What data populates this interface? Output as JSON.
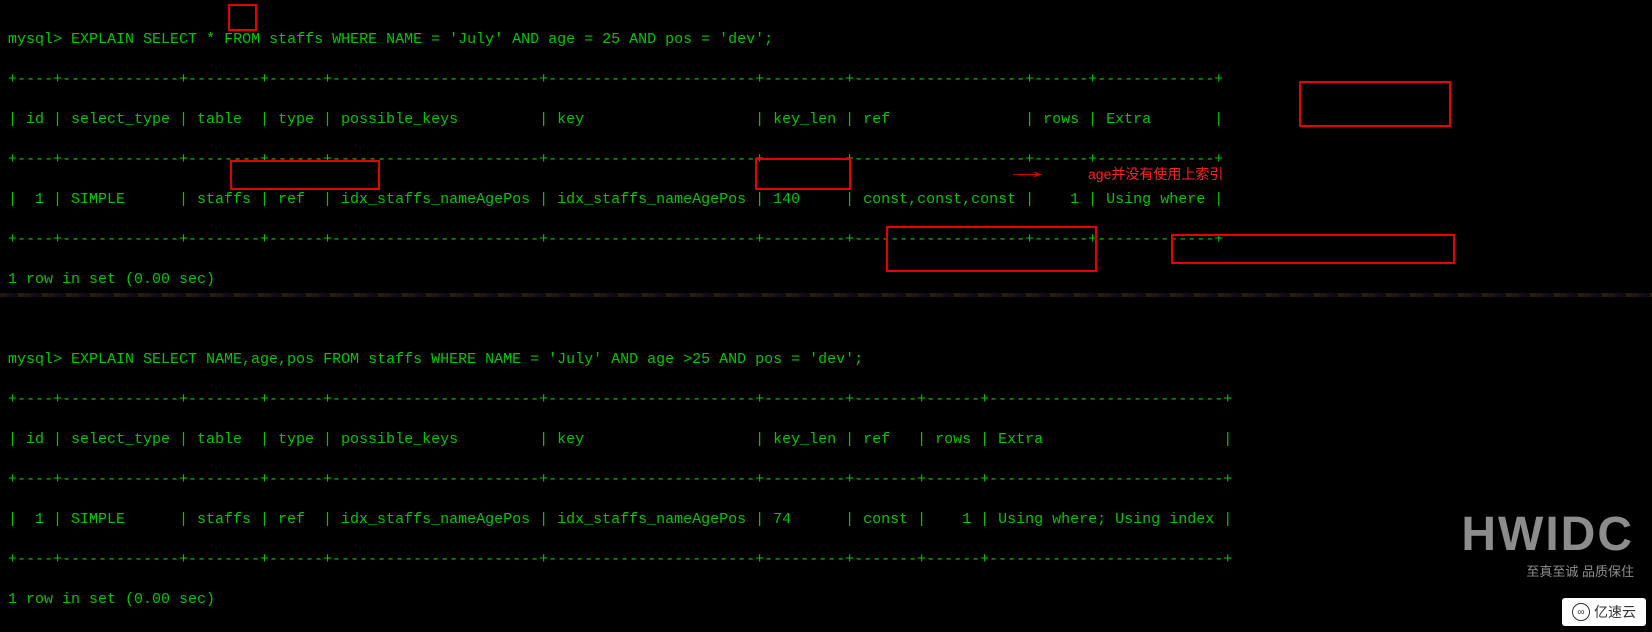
{
  "query1": {
    "prompt": "mysql> ",
    "sql_pre": "EXPLAIN SELECT ",
    "star": "*",
    "sql_post": " FROM staffs WHERE NAME = 'July' AND age = 25 AND pos = 'dev';",
    "sep_top": "+----+-------------+--------+------+-----------------------+-----------------------+---------+-------------------+------+-------------+",
    "header": "| id | select_type | table  | type | possible_keys         | key                   | key_len | ref               | rows | Extra       |",
    "sep_mid": "+----+-------------+--------+------+-----------------------+-----------------------+---------+-------------------+------+-------------+",
    "row": "|  1 | SIMPLE      | staffs | ref  | idx_staffs_nameAgePos | idx_staffs_nameAgePos | 140     | const,const,const |    1 | Using where |",
    "sep_bot": "+----+-------------+--------+------+-----------------------+-----------------------+---------+-------------------+------+-------------+",
    "footer": "1 row in set (0.00 sec)"
  },
  "query2": {
    "prompt": "mysql> ",
    "sql_pre": "EXPLAIN SELECT ",
    "cols": "NAME,age,pos",
    "sql_mid": " FROM staffs WHERE NAME = 'July' AND ",
    "cond": "age >25",
    "sql_post": " AND pos = 'dev';",
    "sep_top": "+----+-------------+--------+------+-----------------------+-----------------------+---------+-------+------+--------------------------+",
    "header": "| id | select_type | table  | type | possible_keys         | key                   | key_len | ref   | rows | Extra                    |",
    "sep_mid": "+----+-------------+--------+------+-----------------------+-----------------------+---------+-------+------+--------------------------+",
    "row": "|  1 | SIMPLE      | staffs | ref  | idx_staffs_nameAgePos | idx_staffs_nameAgePos | 74      | const |    1 | Using where; Using index |",
    "sep_bot": "+----+-------------+--------+------+-----------------------+-----------------------+---------+-------+------+--------------------------+",
    "footer": "1 row in set (0.00 sec)"
  },
  "annotation": "age并没有使用上索引",
  "watermark": {
    "big": "HWIDC",
    "sub": "至真至诚 品质保住",
    "badge": "亿速云"
  },
  "chart_data": [
    {
      "type": "table",
      "title": "EXPLAIN SELECT * FROM staffs WHERE NAME='July' AND age=25 AND pos='dev'",
      "columns": [
        "id",
        "select_type",
        "table",
        "type",
        "possible_keys",
        "key",
        "key_len",
        "ref",
        "rows",
        "Extra"
      ],
      "rows": [
        {
          "id": 1,
          "select_type": "SIMPLE",
          "table": "staffs",
          "type": "ref",
          "possible_keys": "idx_staffs_nameAgePos",
          "key": "idx_staffs_nameAgePos",
          "key_len": 140,
          "ref": "const,const,const",
          "rows": 1,
          "Extra": "Using where"
        }
      ]
    },
    {
      "type": "table",
      "title": "EXPLAIN SELECT NAME,age,pos FROM staffs WHERE NAME='July' AND age>25 AND pos='dev'",
      "columns": [
        "id",
        "select_type",
        "table",
        "type",
        "possible_keys",
        "key",
        "key_len",
        "ref",
        "rows",
        "Extra"
      ],
      "rows": [
        {
          "id": 1,
          "select_type": "SIMPLE",
          "table": "staffs",
          "type": "ref",
          "possible_keys": "idx_staffs_nameAgePos",
          "key": "idx_staffs_nameAgePos",
          "key_len": 74,
          "ref": "const",
          "rows": 1,
          "Extra": "Using where; Using index"
        }
      ]
    }
  ]
}
